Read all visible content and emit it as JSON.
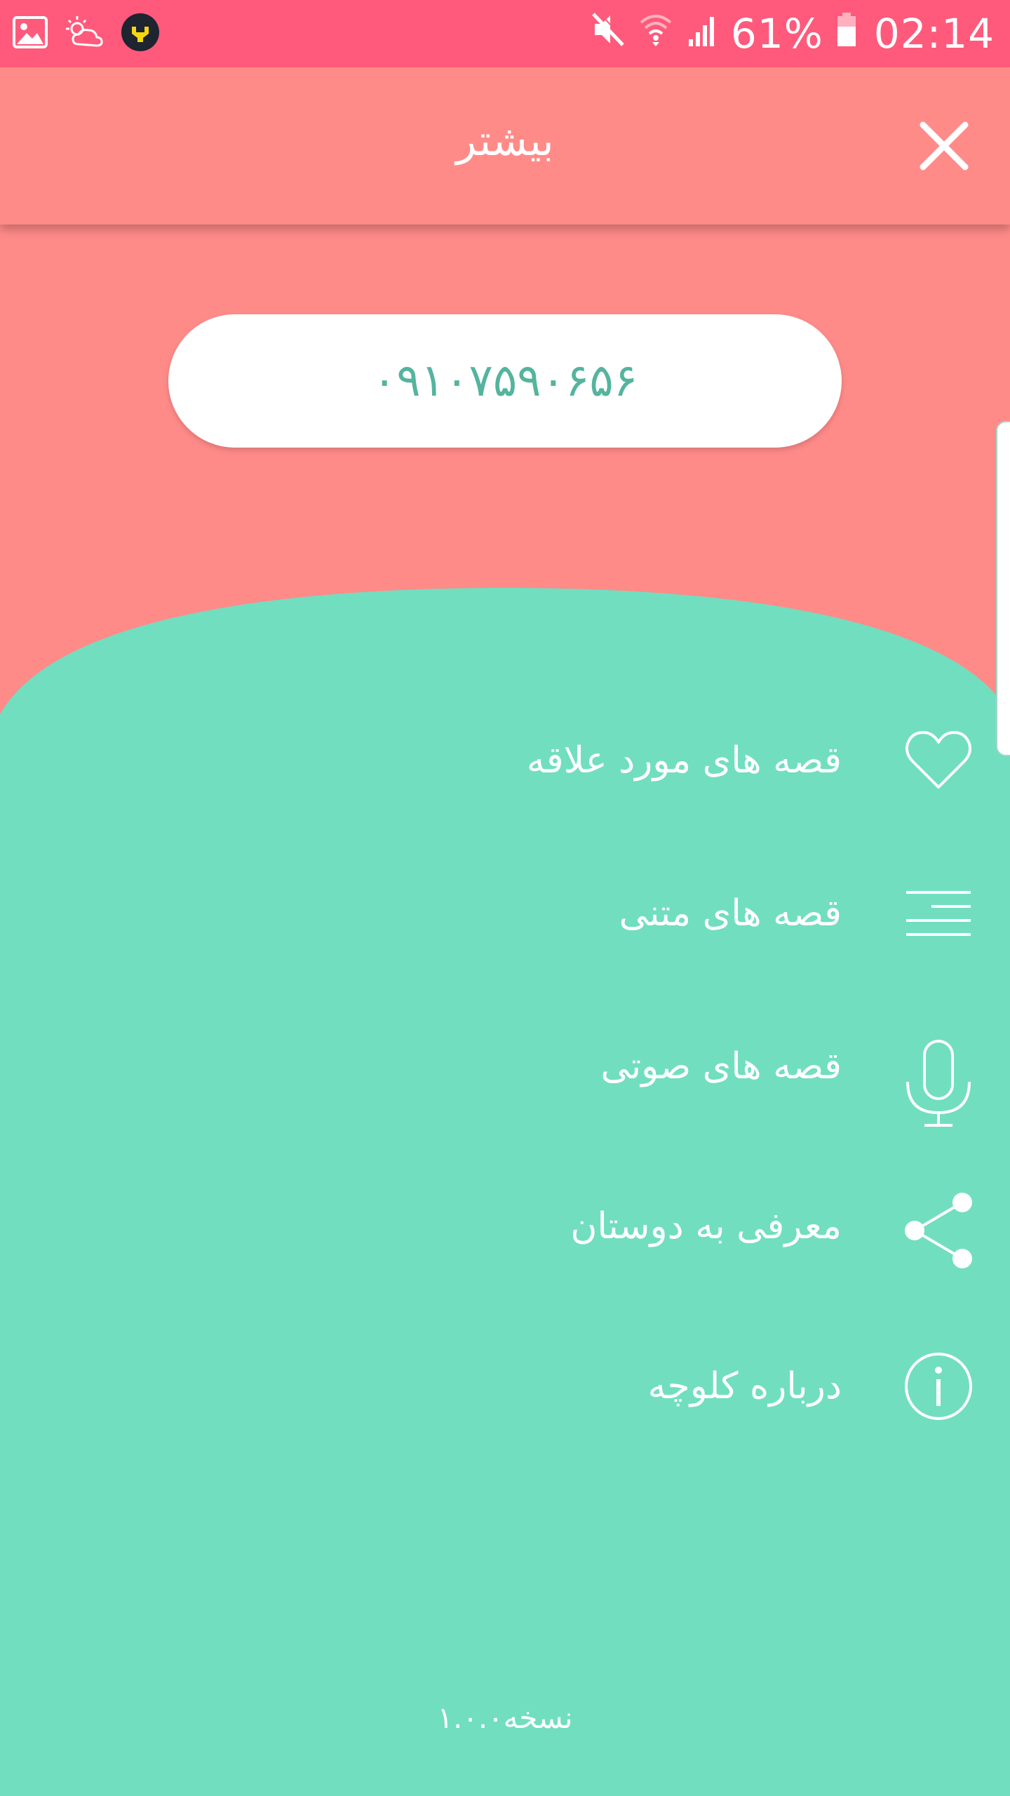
{
  "status_bar": {
    "battery_percent": "61%",
    "time": "02:14",
    "icons": [
      "gallery-icon",
      "weather-icon",
      "app-notification-icon",
      "mute-icon",
      "wifi-icon",
      "signal-icon",
      "battery-icon"
    ]
  },
  "appbar": {
    "title": "بیشتر",
    "close_icon": "close-icon"
  },
  "profile": {
    "phone": "۰۹۱۰۷۵۹۰۶۵۶"
  },
  "menu": {
    "items": [
      {
        "label": "قصه های مورد علاقه",
        "icon": "heart-icon"
      },
      {
        "label": "قصه های متنی",
        "icon": "text-lines-icon"
      },
      {
        "label": "قصه های صوتی",
        "icon": "microphone-icon"
      },
      {
        "label": "معرفی به دوستان",
        "icon": "share-icon"
      },
      {
        "label": "درباره کلوچه",
        "icon": "info-icon"
      }
    ]
  },
  "footer": {
    "version": "نسخه۱.۰.۰"
  },
  "colors": {
    "status_bar": "#FF5A7B",
    "header": "#FF8B89",
    "green": "#71DEC0",
    "phone_text": "#54B49D",
    "white": "#FFFFFF"
  }
}
